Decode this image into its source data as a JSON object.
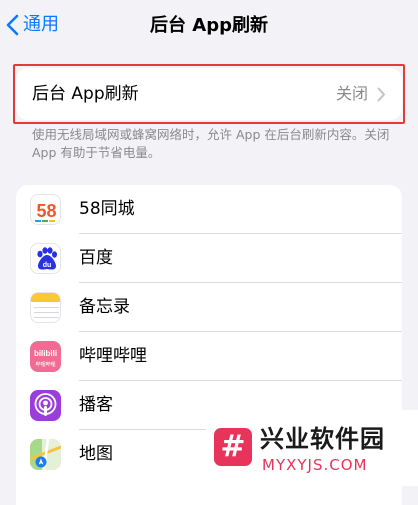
{
  "nav": {
    "back_label": "通用",
    "title": "后台 App刷新"
  },
  "setting": {
    "label": "后台 App刷新",
    "value": "关闭"
  },
  "footnote": "使用无线局域网或蜂窝网络时，允许 App 在后台刷新内容。关闭 App 有助于节省电量。",
  "apps": [
    {
      "name": "58同城",
      "icon": "58-tongcheng-icon"
    },
    {
      "name": "百度",
      "icon": "baidu-icon"
    },
    {
      "name": "备忘录",
      "icon": "notes-icon"
    },
    {
      "name": "哔哩哔哩",
      "icon": "bilibili-icon"
    },
    {
      "name": "播客",
      "icon": "podcasts-icon"
    },
    {
      "name": "地图",
      "icon": "maps-icon"
    }
  ],
  "app_icon_text": {
    "tongcheng": "58",
    "baidu": "du",
    "bilibili": "bilibili",
    "bilibili_sub": "哔哩哔哩"
  },
  "watermark": {
    "badge": "#",
    "title": "兴业软件园",
    "site": "MYXYJS.COM"
  },
  "colors": {
    "accent": "#0a7aff",
    "highlight": "#e23b3b",
    "watermark": "#e8335a"
  }
}
